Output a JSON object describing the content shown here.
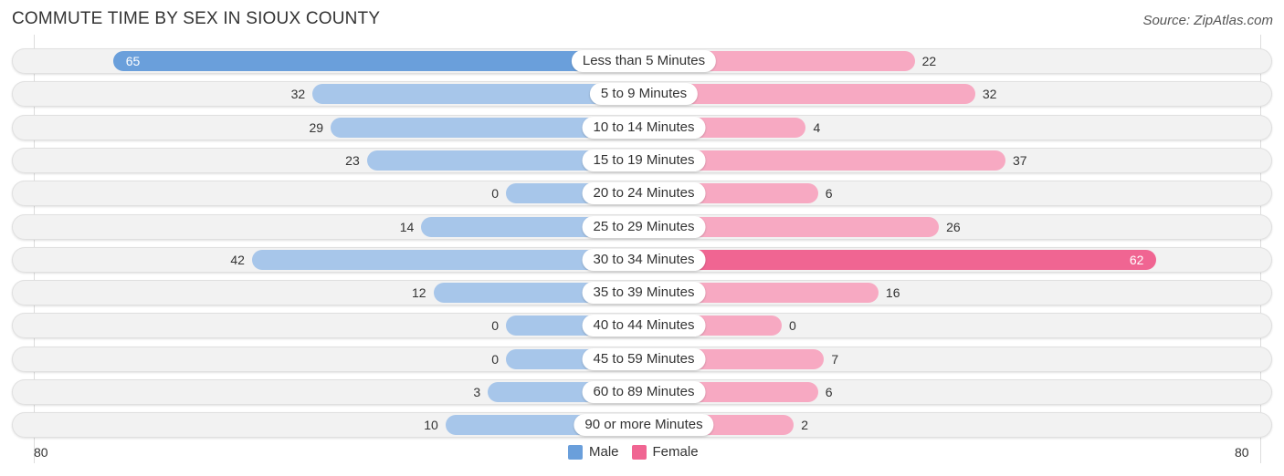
{
  "title": "COMMUTE TIME BY SEX IN SIOUX COUNTY",
  "source": "Source: ZipAtlas.com",
  "colors": {
    "male": "#6a9fdb",
    "male_light": "#a7c6ea",
    "female": "#f06592",
    "female_light": "#f7a9c2"
  },
  "chart_data": {
    "type": "bar",
    "orientation": "horizontal-diverging",
    "title": "COMMUTE TIME BY SEX IN SIOUX COUNTY",
    "categories": [
      "Less than 5 Minutes",
      "5 to 9 Minutes",
      "10 to 14 Minutes",
      "15 to 19 Minutes",
      "20 to 24 Minutes",
      "25 to 29 Minutes",
      "30 to 34 Minutes",
      "35 to 39 Minutes",
      "40 to 44 Minutes",
      "45 to 59 Minutes",
      "60 to 89 Minutes",
      "90 or more Minutes"
    ],
    "series": [
      {
        "name": "Male",
        "values": [
          65,
          32,
          29,
          23,
          0,
          14,
          42,
          12,
          0,
          0,
          3,
          10
        ]
      },
      {
        "name": "Female",
        "values": [
          22,
          32,
          4,
          37,
          6,
          26,
          62,
          16,
          0,
          7,
          6,
          2
        ]
      }
    ],
    "axis": {
      "left_label": "80",
      "right_label": "80",
      "max": 80
    },
    "legend": [
      "Male",
      "Female"
    ],
    "legend_position": "bottom-center"
  }
}
